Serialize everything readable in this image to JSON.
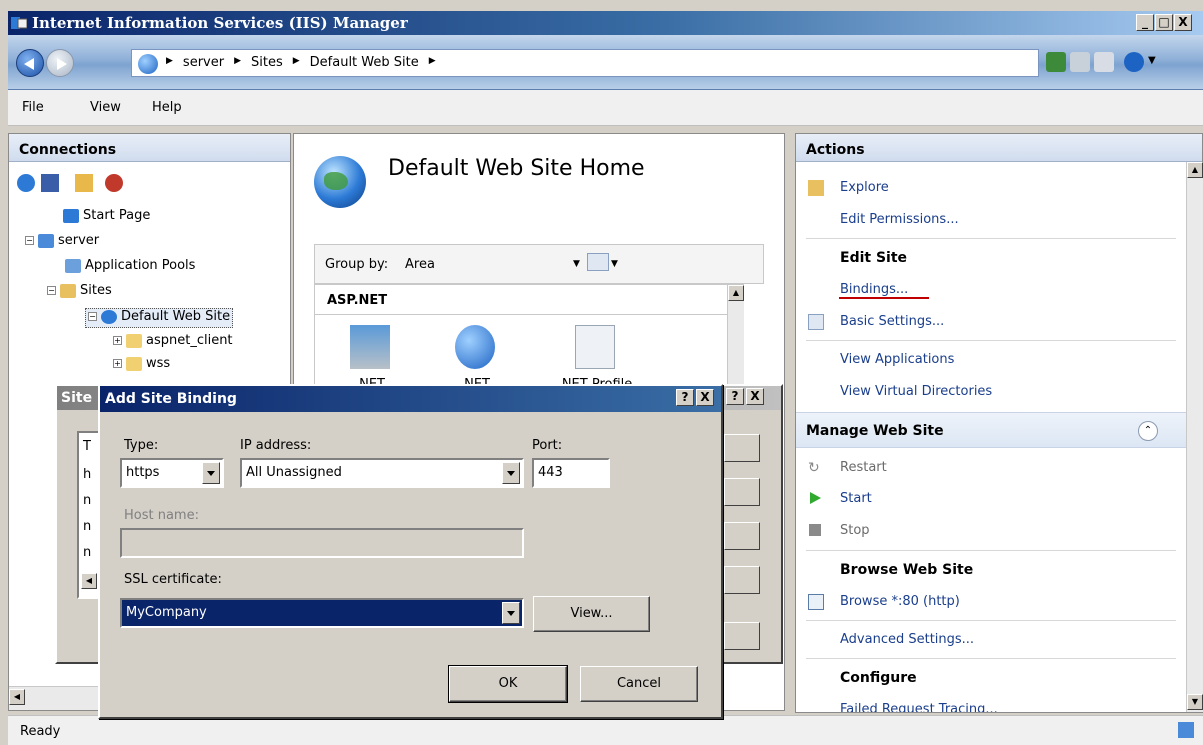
{
  "window": {
    "title": "Internet Information Services (IIS) Manager",
    "minimize": "_",
    "maximize": "□",
    "close": "X"
  },
  "address": {
    "crumbs": [
      "server",
      "Sites",
      "Default Web Site"
    ]
  },
  "menu": {
    "file": "File",
    "view": "View",
    "help": "Help"
  },
  "connections": {
    "header": "Connections",
    "tree": [
      {
        "label": "Start Page"
      },
      {
        "label": "server"
      },
      {
        "label": "Application Pools"
      },
      {
        "label": "Sites"
      },
      {
        "label": "Default Web Site"
      },
      {
        "label": "aspnet_client"
      },
      {
        "label": "wss"
      }
    ]
  },
  "center": {
    "title": "Default Web Site Home",
    "groupby_label": "Group by:",
    "groupby_value": "Area",
    "section": "ASP.NET",
    "features": [
      ".NET Compilation",
      ".NET Globalization",
      ".NET Profile"
    ]
  },
  "actions": {
    "header": "Actions",
    "explore": "Explore",
    "edit_permissions": "Edit Permissions...",
    "edit_site": "Edit Site",
    "bindings": "Bindings...",
    "basic_settings": "Basic Settings...",
    "view_applications": "View Applications",
    "view_virtual_directories": "View Virtual Directories",
    "manage_web_site": "Manage Web Site",
    "restart": "Restart",
    "start": "Start",
    "stop": "Stop",
    "browse_web_site": "Browse Web Site",
    "browse_80": "Browse *:80 (http)",
    "advanced_settings": "Advanced Settings...",
    "configure": "Configure",
    "failed_request_tracing": "Failed Request Tracing..."
  },
  "status": {
    "text": "Ready"
  },
  "bg_dialog": {
    "title": "Site",
    "list_col": "T",
    "list_rows": [
      "h",
      "n",
      "n",
      "n"
    ],
    "help_btn": "?",
    "close_btn": "X"
  },
  "dialog": {
    "title": "Add Site Binding",
    "help_btn": "?",
    "close_btn": "X",
    "type_label": "Type:",
    "type_value": "https",
    "ip_label": "IP address:",
    "ip_value": "All Unassigned",
    "port_label": "Port:",
    "port_value": "443",
    "host_label": "Host name:",
    "host_value": "",
    "ssl_label": "SSL certificate:",
    "ssl_value": "MyCompany",
    "view_btn": "View...",
    "ok_btn": "OK",
    "cancel_btn": "Cancel"
  },
  "colors": {
    "title_bar": "#0a246a",
    "link": "#1a3e8c",
    "highlight_underline": "#c00000"
  }
}
